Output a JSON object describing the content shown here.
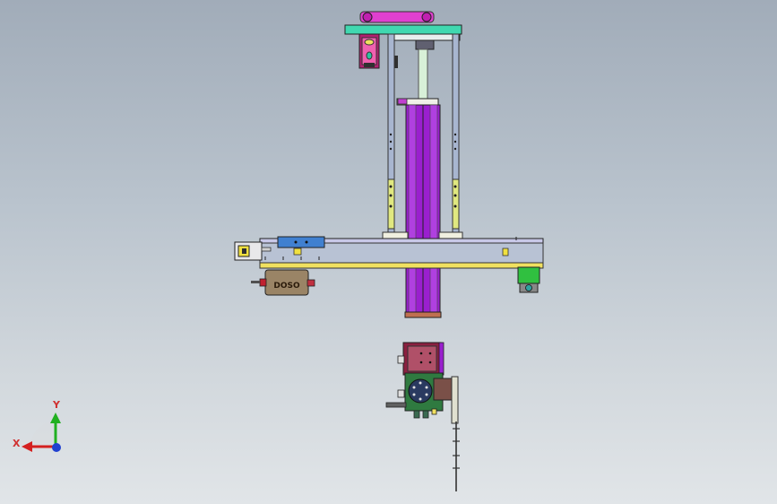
{
  "viewport": {
    "background_top": "#a1acb9",
    "background_bottom": "#e1e5e8"
  },
  "triad": {
    "x_label": "X",
    "y_label": "Y",
    "x_color": "#d42020",
    "y_color": "#20b020",
    "z_color": "#2040d0"
  },
  "model": {
    "column_color": "#9a1fcf",
    "arm_color": "#e030c8",
    "bracket_color": "#30d0a0",
    "rail_color": "#f0e060",
    "motor_color": "#30c040",
    "drive_label": "DOSO"
  }
}
